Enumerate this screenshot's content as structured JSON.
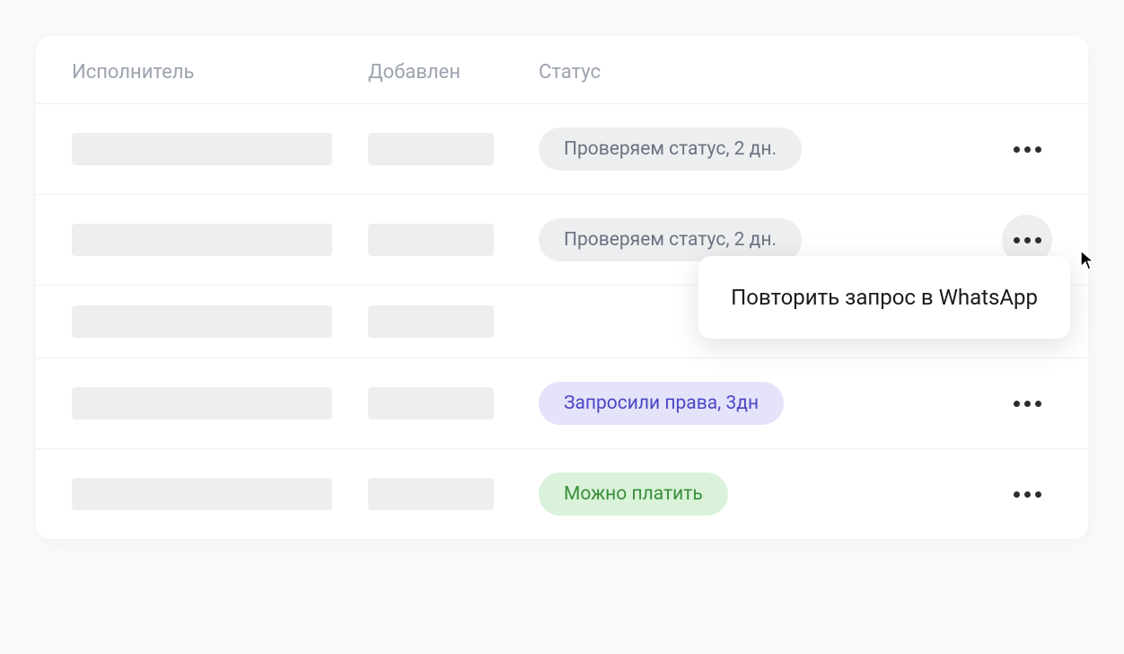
{
  "headers": {
    "executor": "Исполнитель",
    "added": "Добавлен",
    "status": "Статус"
  },
  "rows": [
    {
      "status_text": "Проверяем статус, 2 дн.",
      "status_type": "gray",
      "has_popover": false,
      "button_active": false
    },
    {
      "status_text": "Проверяем статус, 2 дн.",
      "status_type": "gray",
      "has_popover": true,
      "button_active": true
    },
    {
      "status_text": "",
      "status_type": "",
      "has_popover": false,
      "button_active": false,
      "hide_status": true,
      "hide_actions": true
    },
    {
      "status_text": "Запросили права, 3дн",
      "status_type": "purple",
      "has_popover": false,
      "button_active": false
    },
    {
      "status_text": "Можно платить",
      "status_type": "green",
      "has_popover": false,
      "button_active": false
    }
  ],
  "popover": {
    "text": "Повторить запрос в WhatsApp"
  }
}
